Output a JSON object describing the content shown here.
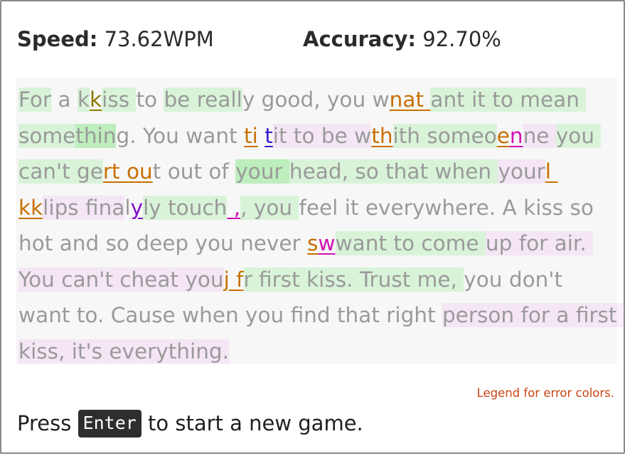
{
  "stats": {
    "speed_label": "Speed:",
    "speed_value": "73.62WPM",
    "accuracy_label": "Accuracy:",
    "accuracy_value": "92.70%"
  },
  "passage_segments": [
    {
      "t": "For",
      "c": "g1"
    },
    {
      "t": " a ",
      "c": ""
    },
    {
      "t": "k",
      "c": "g1"
    },
    {
      "t": "k",
      "c": "err-y"
    },
    {
      "t": "iss ",
      "c": "g1"
    },
    {
      "t": "to ",
      "c": ""
    },
    {
      "t": "be ",
      "c": "g1"
    },
    {
      "t": "reall",
      "c": "g1"
    },
    {
      "t": "y good, you w",
      "c": ""
    },
    {
      "t": "nat ",
      "c": "err-o"
    },
    {
      "t": "ant it to ",
      "c": "g1"
    },
    {
      "t": "mean ",
      "c": "g1"
    },
    {
      "t": "some",
      "c": "g1"
    },
    {
      "t": "thin",
      "c": "g2"
    },
    {
      "t": "g. You want ",
      "c": ""
    },
    {
      "t": "ti",
      "c": "err-o"
    },
    {
      "t": " ",
      "c": ""
    },
    {
      "t": "t",
      "c": "err-b"
    },
    {
      "t": "it to be w",
      "c": "p1"
    },
    {
      "t": "th",
      "c": "err-o"
    },
    {
      "t": "ith someo",
      "c": "g1"
    },
    {
      "t": "e",
      "c": "err-o"
    },
    {
      "t": "n",
      "c": "err-m"
    },
    {
      "t": "ne ",
      "c": "p1"
    },
    {
      "t": "you can't ge",
      "c": "g1"
    },
    {
      "t": "rt ou",
      "c": "err-o"
    },
    {
      "t": "t out of ",
      "c": ""
    },
    {
      "t": "your ",
      "c": "g2"
    },
    {
      "t": "head, so that when ",
      "c": "g1"
    },
    {
      "t": "your",
      "c": "p1"
    },
    {
      "t": "l kk",
      "c": "err-o"
    },
    {
      "t": "lips fina",
      "c": "p1"
    },
    {
      "t": "l",
      "c": ""
    },
    {
      "t": "y",
      "c": "err-v"
    },
    {
      "t": "ly touch",
      "c": "g1"
    },
    {
      "t": " ,",
      "c": "err-m"
    },
    {
      "t": ", you ",
      "c": "g1"
    },
    {
      "t": "feel it everywhere. A ",
      "c": ""
    },
    {
      "t": "kiss so hot and so deep you never ",
      "c": ""
    },
    {
      "t": "s",
      "c": "err-o"
    },
    {
      "t": "w",
      "c": "err-m"
    },
    {
      "t": "want to come ",
      "c": "g1"
    },
    {
      "t": "up for air. You can't cheat you",
      "c": "p1"
    },
    {
      "t": "j f",
      "c": "err-o"
    },
    {
      "t": "r first kiss. Trust me, ",
      "c": "g1"
    },
    {
      "t": "you don't want to. Cause when you find that right ",
      "c": ""
    },
    {
      "t": "person for a first kiss, it's everything.",
      "c": "p1"
    }
  ],
  "legend_link": "Legend for error colors.",
  "prompt": {
    "before": "Press",
    "key": "Enter",
    "after": "to start a new game."
  }
}
